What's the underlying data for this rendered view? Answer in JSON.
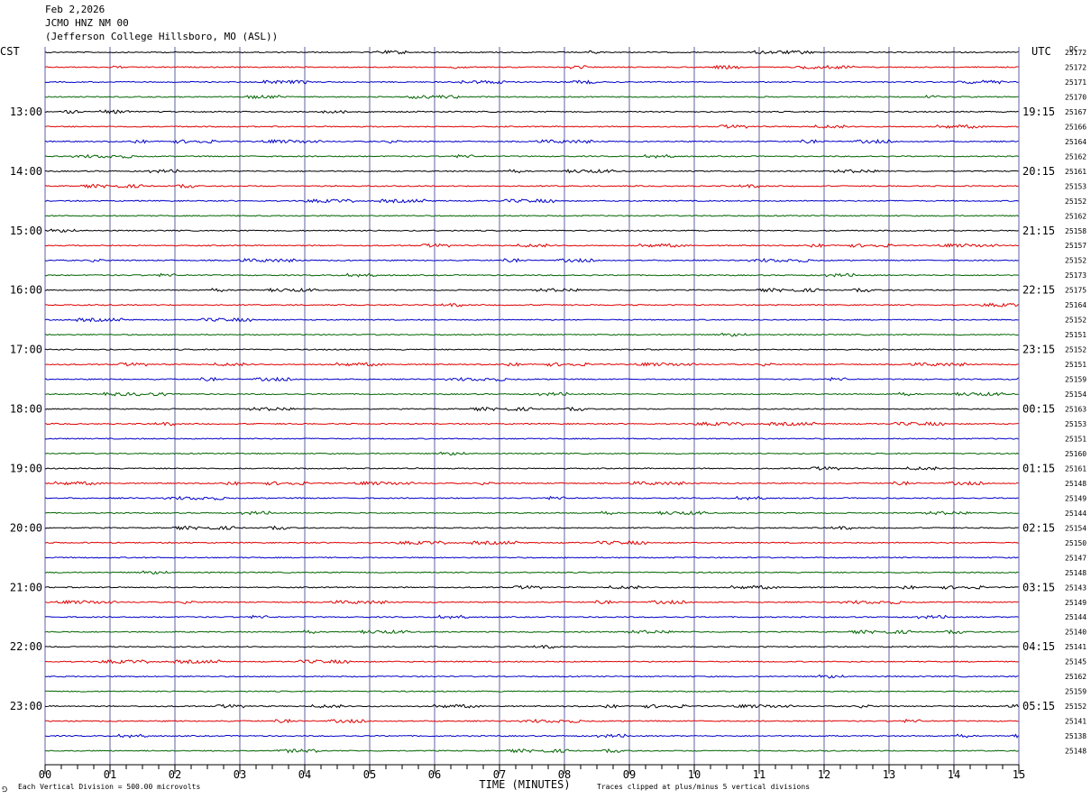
{
  "header": {
    "date": "Feb 2,2026",
    "station": "JCMO HNZ NM 00",
    "location": "(Jefferson College Hillsboro, MO (ASL))"
  },
  "left_timezone": "CST",
  "right_timezone": "UTC",
  "dc_label": "DC",
  "footer": {
    "scale_note": "Each Vertical Division =  500.00 microvolts",
    "clip_note": "Traces clipped at plus/minus 5 vertical divisions",
    "corner_mark": "⅁"
  },
  "colors": {
    "trace_cycle": [
      "#000000",
      "#e00000",
      "#0000c8",
      "#006400"
    ],
    "grid_vertical": "#6060a0"
  },
  "chart_data": {
    "type": "line",
    "xlabel": "TIME (MINUTES)",
    "xlim": [
      0,
      15
    ],
    "x_ticks": [
      "00",
      "01",
      "02",
      "03",
      "04",
      "05",
      "06",
      "07",
      "08",
      "09",
      "10",
      "11",
      "12",
      "13",
      "14",
      "15"
    ],
    "minor_ticks_per_minute": 4,
    "left_time_labels": [
      "13:00",
      "14:00",
      "15:00",
      "16:00",
      "17:00",
      "18:00",
      "19:00",
      "20:00",
      "21:00",
      "22:00",
      "23:00"
    ],
    "right_time_labels": [
      "19:15",
      "20:15",
      "21:15",
      "22:15",
      "23:15",
      "00:15",
      "01:15",
      "02:15",
      "03:15",
      "04:15",
      "05:15"
    ],
    "first_labeled_trace": 4,
    "traces_per_hour": 4,
    "dc_offsets": [
      "25172",
      "25172",
      "25171",
      "25170",
      "25167",
      "25166",
      "25164",
      "25162",
      "25161",
      "25153",
      "25152",
      "25162",
      "25158",
      "25157",
      "25152",
      "25173",
      "25175",
      "25164",
      "25152",
      "25151",
      "25152",
      "25151",
      "25159",
      "25154",
      "25163",
      "25153",
      "25151",
      "25160",
      "25161",
      "25148",
      "25149",
      "25144",
      "25154",
      "25150",
      "25147",
      "25148",
      "25143",
      "25149",
      "25144",
      "25140",
      "25141",
      "25145",
      "25162",
      "25159",
      "25152",
      "25141",
      "25138",
      "25148"
    ]
  }
}
